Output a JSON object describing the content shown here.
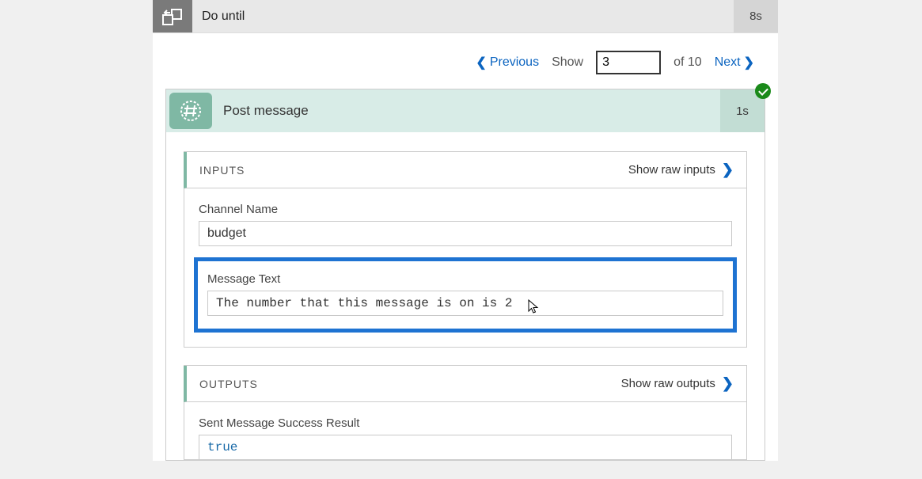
{
  "doUntil": {
    "title": "Do until",
    "duration": "8s"
  },
  "pager": {
    "previous": "Previous",
    "showLabel": "Show",
    "pageValue": "3",
    "ofText": "of 10",
    "next": "Next"
  },
  "postMessage": {
    "title": "Post message",
    "duration": "1s"
  },
  "inputsSection": {
    "heading": "INPUTS",
    "showRaw": "Show raw inputs",
    "channelName": {
      "label": "Channel Name",
      "value": "budget"
    },
    "messageText": {
      "label": "Message Text",
      "value": "The number that this message is on is 2"
    }
  },
  "outputsSection": {
    "heading": "OUTPUTS",
    "showRaw": "Show raw outputs",
    "sentSuccess": {
      "label": "Sent Message Success Result",
      "value": "true"
    }
  }
}
